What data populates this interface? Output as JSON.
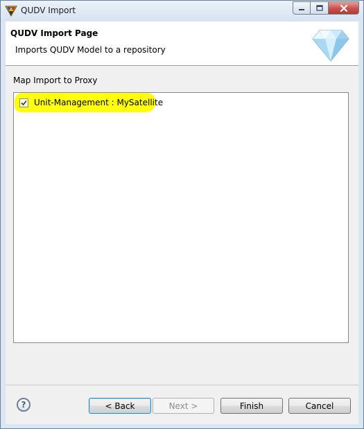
{
  "window": {
    "title": "QUDV Import",
    "controls": {
      "minimize": "minimize-icon",
      "maximize": "maximize-icon",
      "close": "close-icon"
    }
  },
  "banner": {
    "title": "QUDV Import Page",
    "description": "Imports QUDV Model to a repository",
    "image": "diamond-icon"
  },
  "section": {
    "label": "Map Import to Proxy"
  },
  "tree": {
    "items": [
      {
        "label": "Unit-Management : MySatellite",
        "checked": true,
        "highlighted": true
      }
    ]
  },
  "footer": {
    "help_icon": "question-mark-icon",
    "help_glyph": "?",
    "back_label": "< Back",
    "next_label": "Next >",
    "next_enabled": false,
    "finish_label": "Finish",
    "cancel_label": "Cancel"
  },
  "colors": {
    "highlight": "#ffff00",
    "window_frame": "#dbe6f3",
    "close_button": "#c75050"
  }
}
